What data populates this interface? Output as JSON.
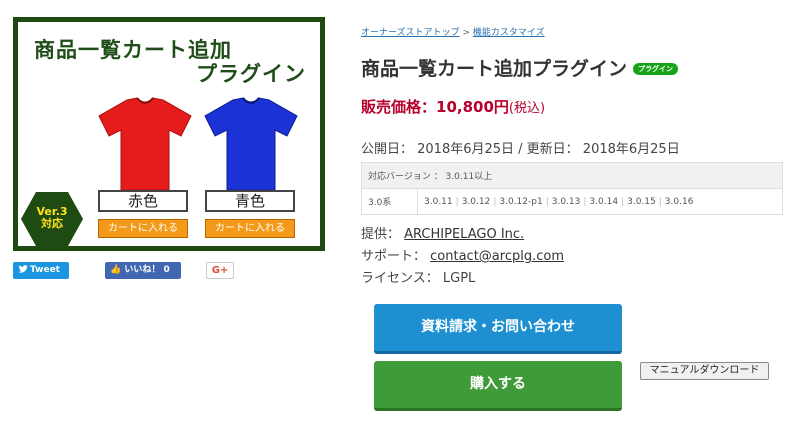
{
  "product_image": {
    "title_line1": "商品一覧カート追加",
    "title_line2": "プラグイン",
    "shirts": [
      {
        "color_label": "赤色",
        "cart_label": "カートに入れる",
        "color": "#e61b1b"
      },
      {
        "color_label": "青色",
        "cart_label": "カートに入れる",
        "color": "#1b33d6"
      }
    ],
    "version_badge_line1": "Ver.3",
    "version_badge_line2": "対応",
    "frame_color": "#1f4a12"
  },
  "social": {
    "tweet_label": "Tweet",
    "like_label": "いいね！ 0",
    "gplus_label": "G+"
  },
  "breadcrumb": {
    "home": "オーナーズストアトップ",
    "separator": ">",
    "category": "機能カスタマイズ"
  },
  "product": {
    "title": "商品一覧カート追加プラグイン",
    "badge": "プラグイン",
    "price_label": "販売価格：10,800円",
    "price_tax": "(税込)",
    "dates": "公開日： 2018年6月25日 / 更新日： 2018年6月25日"
  },
  "version_table": {
    "header": "対応バージョン ： 3.0.11以上",
    "row_label": "3.0系",
    "versions": [
      "3.0.11",
      "3.0.12",
      "3.0.12-p1",
      "3.0.13",
      "3.0.14",
      "3.0.15",
      "3.0.16"
    ]
  },
  "meta": {
    "provider_label": "提供：",
    "provider_value": "ARCHIPELAGO Inc.",
    "support_label": "サポート：",
    "support_value": "contact@arcplg.com",
    "license_label": "ライセンス：",
    "license_value": "LGPL"
  },
  "actions": {
    "inquiry_label": "資料請求・お問い合わせ",
    "buy_label": "購入する",
    "manual_label": "マニュアルダウンロード"
  },
  "colors": {
    "price": "#b8002b",
    "inquiry_button": "#1e8fd0",
    "buy_button": "#3f9b3a",
    "plugin_badge": "#17a317"
  }
}
